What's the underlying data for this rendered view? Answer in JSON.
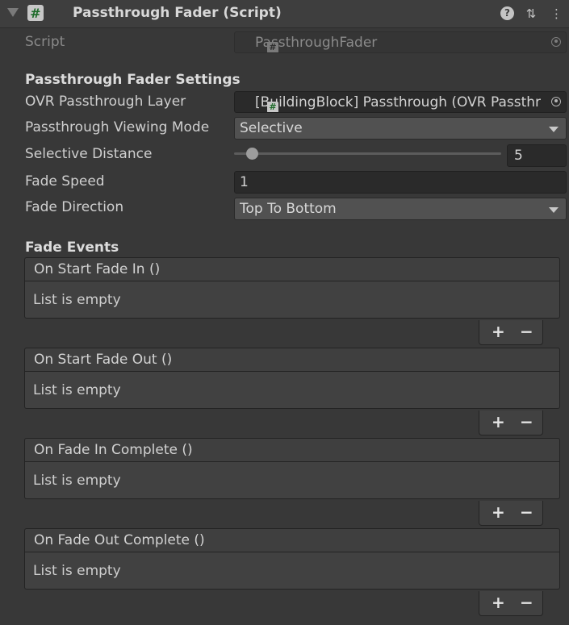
{
  "header": {
    "title": "Passthrough Fader (Script)",
    "script_icon": "#",
    "help_icon": "?",
    "presets_icon": "⇅",
    "menu_icon": "⋮"
  },
  "script_field": {
    "label": "Script",
    "value": "PassthroughFader"
  },
  "settings": {
    "section_title": "Passthrough Fader Settings",
    "layer_label": "OVR Passthrough Layer",
    "layer_value": "[BuildingBlock] Passthrough (OVR Passthr",
    "mode_label": "Passthrough Viewing Mode",
    "mode_value": "Selective",
    "distance_label": "Selective Distance",
    "distance_value": "5",
    "speed_label": "Fade Speed",
    "speed_value": "1",
    "direction_label": "Fade Direction",
    "direction_value": "Top To Bottom"
  },
  "events": {
    "section_title": "Fade Events",
    "items": [
      {
        "name": "On Start Fade In ()",
        "empty": "List is empty"
      },
      {
        "name": "On Start Fade Out ()",
        "empty": "List is empty"
      },
      {
        "name": "On Fade In Complete ()",
        "empty": "List is empty"
      },
      {
        "name": "On Fade Out Complete ()",
        "empty": "List is empty"
      }
    ],
    "add_label": "+",
    "remove_label": "−"
  }
}
